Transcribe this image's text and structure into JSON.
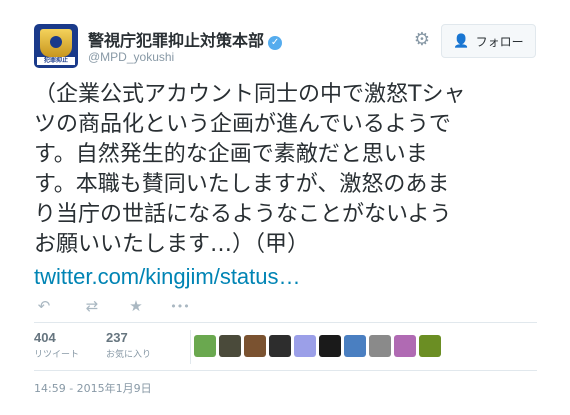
{
  "account": {
    "display_name": "警視庁犯罪抑止対策本部",
    "handle": "@MPD_yokushi",
    "avatar_strip": "犯罪抑止"
  },
  "header": {
    "follow_label": "フォロー"
  },
  "tweet": {
    "lines": [
      "（企業公式アカウント同士の中で激怒Tシャ",
      "ツの商品化という企画が進んでいるようで",
      "す。自然発生的な企画で素敵だと思いま",
      "す。本職も賛同いたしますが、激怒のあま",
      "り当庁の世話になるようなことがないよう",
      "お願いいたします…）（甲）"
    ],
    "link": "twitter.com/kingjim/status…"
  },
  "actions": [
    {
      "name": "reply-icon",
      "glyph": "↶"
    },
    {
      "name": "retweet-icon",
      "glyph": "⇄"
    },
    {
      "name": "favorite-icon",
      "glyph": "★"
    },
    {
      "name": "more-icon",
      "glyph": "•••"
    }
  ],
  "stats": {
    "retweets": {
      "count": "404",
      "label": "リツイート"
    },
    "favorites": {
      "count": "237",
      "label": "お気に入り"
    }
  },
  "favoriters": [
    "#6aa84f",
    "#4a4a3a",
    "#7a5230",
    "#2d2d2d",
    "#9b9fe8",
    "#1a1a1a",
    "#4a7fc1",
    "#8a8a8a",
    "#b06ab3",
    "#6b8e23"
  ],
  "timestamp": "14:59 - 2015年1月9日"
}
